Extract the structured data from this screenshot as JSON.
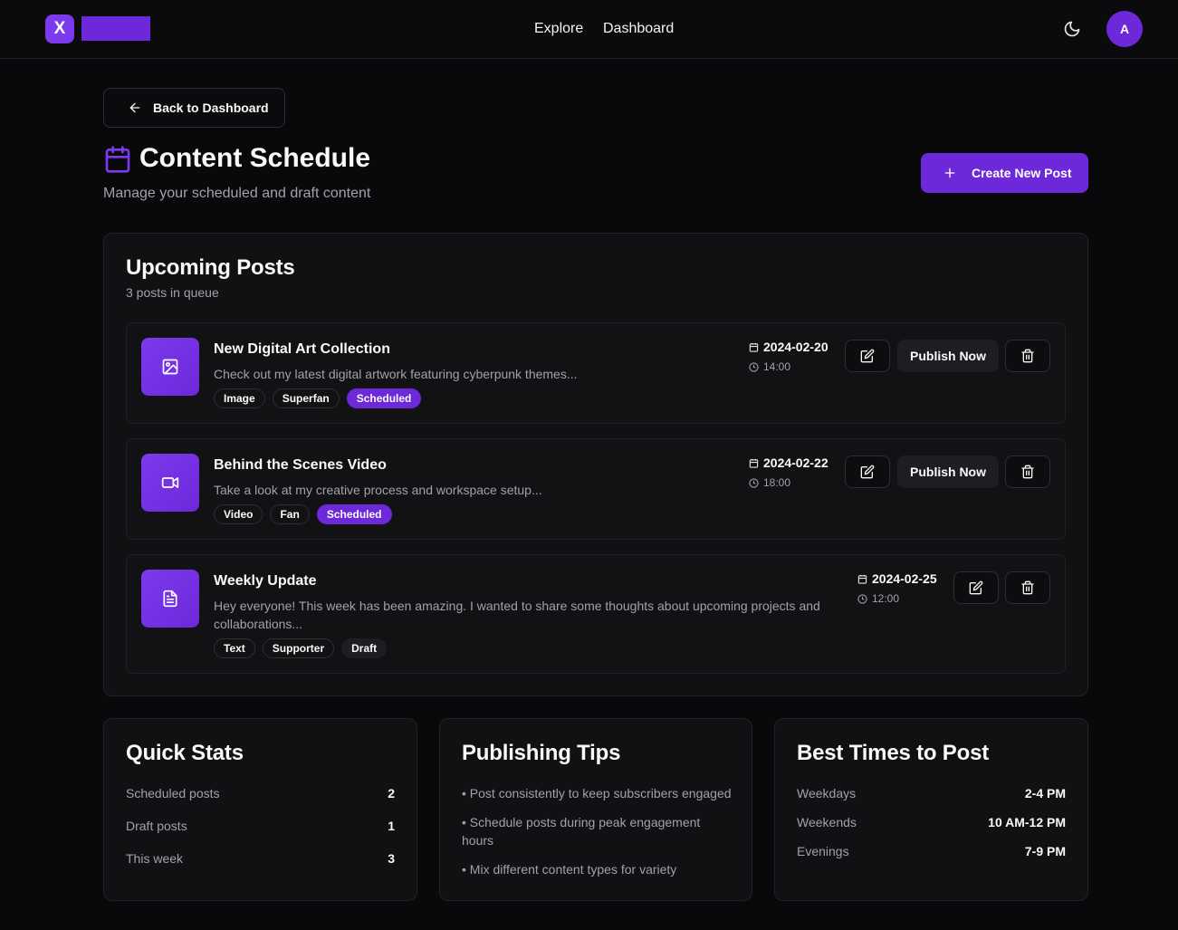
{
  "nav": {
    "logo_letter": "X",
    "links": [
      "Explore",
      "Dashboard"
    ],
    "avatar_initial": "A",
    "theme_icon": "moon-icon"
  },
  "header": {
    "back_label": "Back to Dashboard",
    "title": "Content Schedule",
    "subtitle": "Manage your scheduled and draft content",
    "create_label": "Create New Post"
  },
  "upcoming": {
    "title": "Upcoming Posts",
    "count_text": "3 posts in queue",
    "publish_label": "Publish Now",
    "posts": [
      {
        "title": "New Digital Art Collection",
        "description": "Check out my latest digital artwork featuring cyberpunk themes...",
        "type_icon": "image-icon",
        "tags": [
          "Image",
          "Superfan",
          "Scheduled"
        ],
        "date": "2024-02-20",
        "time": "14:00"
      },
      {
        "title": "Behind the Scenes Video",
        "description": "Take a look at my creative process and workspace setup...",
        "type_icon": "video-icon",
        "tags": [
          "Video",
          "Fan",
          "Scheduled"
        ],
        "date": "2024-02-22",
        "time": "18:00"
      },
      {
        "title": "Weekly Update",
        "description_line1": "Hey everyone! This week has been amazing. I wanted to share some thoughts about upcoming projects and",
        "description_line2": "collaborations...",
        "type_icon": "document-icon",
        "tags": [
          "Text",
          "Supporter",
          "Draft"
        ],
        "date": "2024-02-25",
        "time": "12:00"
      }
    ]
  },
  "quick_stats": {
    "title": "Quick Stats",
    "rows": [
      {
        "label": "Scheduled posts",
        "value": "2"
      },
      {
        "label": "Draft posts",
        "value": "1"
      },
      {
        "label": "This week",
        "value": "3"
      }
    ]
  },
  "tips": {
    "title": "Publishing Tips",
    "items": [
      "• Post consistently to keep subscribers engaged",
      "• Schedule posts during peak engagement hours",
      "• Mix different content types for variety"
    ]
  },
  "best_times": {
    "title": "Best Times to Post",
    "rows": [
      {
        "label": "Weekdays",
        "value": "2-4 PM"
      },
      {
        "label": "Weekends",
        "value": "10 AM-12 PM"
      },
      {
        "label": "Evenings",
        "value": "7-9 PM"
      }
    ]
  },
  "colors": {
    "accent": "#6d28d9",
    "accent_light": "#7c3aed",
    "background": "#09090b",
    "card": "#111114",
    "muted_text": "#a1a1aa"
  }
}
